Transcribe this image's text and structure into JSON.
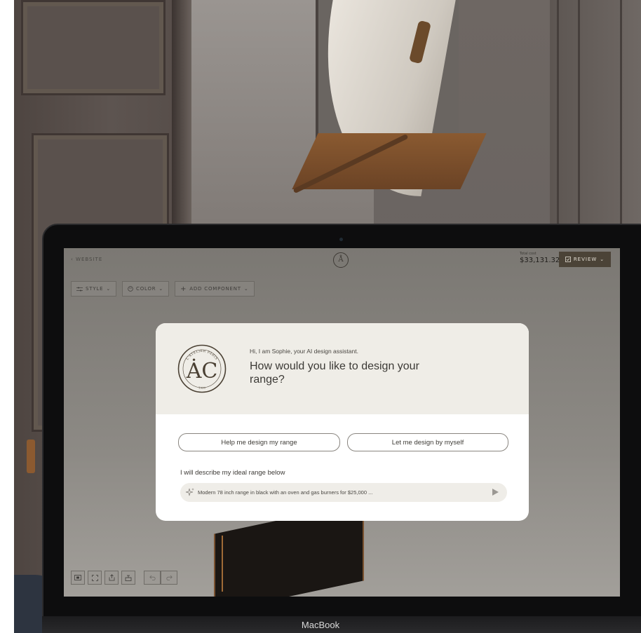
{
  "app": {
    "back_link": "‹ WEBSITE",
    "logo_glyph": "Å",
    "cost_label": "Total cost",
    "cost_value": "$33,131.32",
    "review_label": "REVIEW",
    "review_chevron": "⌄"
  },
  "toolbar": {
    "style_label": "STYLE",
    "color_label": "COLOR",
    "add_label": "ADD COMPONENT",
    "chevron": "⌄"
  },
  "dialog": {
    "emblem_text_top": "L'ATELIER PARIS",
    "emblem_letters": "ȦC",
    "emblem_year": "1930",
    "greeting": "Hi, I am Sophie, your AI design assistant.",
    "question": "How would you like to design your range?",
    "option_help": "Help me design my range",
    "option_self": "Let me design by myself",
    "describe_label": "I will describe my ideal range below",
    "prompt_value": "Modern 78 inch range in black with an oven and gas burners for $25,000 ..."
  },
  "bottom_tools": {
    "icons": [
      "screen-icon",
      "fullscreen-icon",
      "share-icon",
      "range-icon",
      "undo-icon",
      "redo-icon"
    ]
  },
  "device": {
    "brand": "MacBook"
  },
  "colors": {
    "review_bg": "#4b4337",
    "dialog_head_bg": "#efede7",
    "dialog_bg": "#ffffff"
  }
}
